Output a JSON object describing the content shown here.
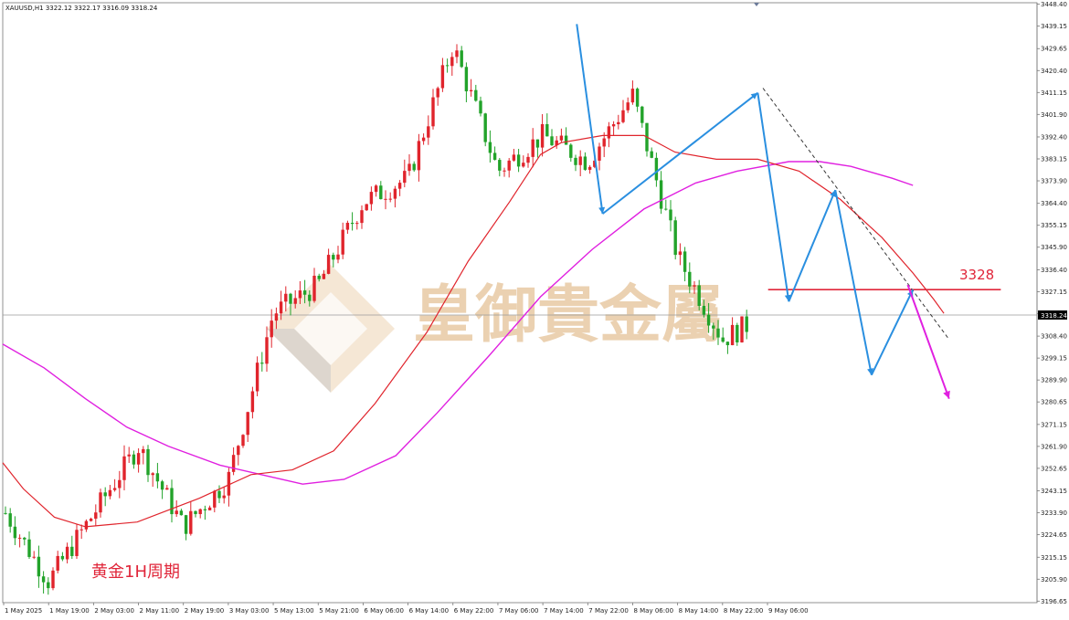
{
  "header": {
    "info": "XAUUSD,H1  3322.12 3322.17 3316.09 3318.24"
  },
  "watermark": {
    "text": "皇御貴金屬"
  },
  "annotations": {
    "period_label": "黄金1H周期",
    "level_label": "3328"
  },
  "colors": {
    "bull": "#e0242c",
    "bear": "#22a32a",
    "ma_fast": "#e0242c",
    "ma_slow": "#e020e0",
    "zigzag": "#2a8fe0",
    "level": "#e0263a",
    "projection": "#e020e0",
    "trend": "#333333"
  },
  "chart_data": {
    "type": "candlestick",
    "symbol": "XAUUSD",
    "timeframe": "H1",
    "current_price": "3318.24",
    "ylim": [
      3196,
      3449
    ],
    "yticks": [
      "3448.40",
      "3439.15",
      "3429.65",
      "3420.40",
      "3411.15",
      "3401.90",
      "3392.40",
      "3383.15",
      "3373.90",
      "3364.40",
      "3355.15",
      "3345.90",
      "3336.40",
      "3327.15",
      "3317.90",
      "3308.40",
      "3299.15",
      "3289.90",
      "3280.65",
      "3271.15",
      "3261.90",
      "3252.65",
      "3243.15",
      "3233.90",
      "3224.65",
      "3215.15",
      "3205.90",
      "3196.65"
    ],
    "xticks": [
      "1 May 2025",
      "1 May 19:00",
      "2 May 03:00",
      "2 May 11:00",
      "2 May 19:00",
      "3 May 03:00",
      "5 May 13:00",
      "5 May 21:00",
      "6 May 06:00",
      "6 May 14:00",
      "6 May 22:00",
      "7 May 06:00",
      "7 May 14:00",
      "7 May 22:00",
      "8 May 06:00",
      "8 May 14:00",
      "8 May 22:00",
      "9 May 06:00"
    ],
    "key_points": [
      {
        "x": "1 May 2025",
        "y": 3235
      },
      {
        "x": "1 May 19:00",
        "y": 3205
      },
      {
        "x": "2 May 11:00",
        "y": 3262
      },
      {
        "x": "2 May 19:00",
        "y": 3228
      },
      {
        "x": "3 May 03:00",
        "y": 3248
      },
      {
        "x": "5 May 13:00",
        "y": 3318
      },
      {
        "x": "5 May 21:00",
        "y": 3330
      },
      {
        "x": "6 May 06:00",
        "y": 3365
      },
      {
        "x": "6 May 14:00",
        "y": 3375
      },
      {
        "x": "6 May 22:00",
        "y": 3431
      },
      {
        "x": "7 May 06:00",
        "y": 3378
      },
      {
        "x": "7 May 14:00",
        "y": 3393
      },
      {
        "x": "7 May 22:00",
        "y": 3382
      },
      {
        "x": "8 May 06:00",
        "y": 3410
      },
      {
        "x": "8 May 14:00",
        "y": 3342
      },
      {
        "x": "8 May 22:00",
        "y": 3307
      },
      {
        "x": "9 May 06:00",
        "y": 3318
      }
    ],
    "ma_fast": [
      [
        0,
        3255
      ],
      [
        0.02,
        3244
      ],
      [
        0.05,
        3232
      ],
      [
        0.08,
        3228
      ],
      [
        0.13,
        3230
      ],
      [
        0.19,
        3240
      ],
      [
        0.24,
        3250
      ],
      [
        0.28,
        3252
      ],
      [
        0.32,
        3260
      ],
      [
        0.36,
        3280
      ],
      [
        0.41,
        3310
      ],
      [
        0.45,
        3340
      ],
      [
        0.49,
        3365
      ],
      [
        0.52,
        3385
      ],
      [
        0.54,
        3390
      ],
      [
        0.58,
        3393
      ],
      [
        0.62,
        3393
      ],
      [
        0.65,
        3386
      ],
      [
        0.69,
        3383
      ],
      [
        0.73,
        3383
      ],
      [
        0.77,
        3378
      ],
      [
        0.81,
        3366
      ],
      [
        0.85,
        3350
      ],
      [
        0.88,
        3335
      ],
      [
        0.9,
        3324
      ],
      [
        0.91,
        3318
      ]
    ],
    "ma_slow": [
      [
        0,
        3305
      ],
      [
        0.04,
        3295
      ],
      [
        0.08,
        3282
      ],
      [
        0.12,
        3270
      ],
      [
        0.16,
        3262
      ],
      [
        0.21,
        3254
      ],
      [
        0.25,
        3250
      ],
      [
        0.29,
        3246
      ],
      [
        0.33,
        3248
      ],
      [
        0.38,
        3258
      ],
      [
        0.42,
        3276
      ],
      [
        0.47,
        3300
      ],
      [
        0.52,
        3325
      ],
      [
        0.57,
        3345
      ],
      [
        0.62,
        3362
      ],
      [
        0.67,
        3373
      ],
      [
        0.71,
        3378
      ],
      [
        0.76,
        3382
      ],
      [
        0.79,
        3382
      ],
      [
        0.82,
        3380
      ],
      [
        0.86,
        3375
      ],
      [
        0.88,
        3372
      ]
    ],
    "zigzag": [
      [
        0.555,
        3440
      ],
      [
        0.58,
        3360
      ],
      [
        0.73,
        3411
      ],
      [
        0.76,
        3323
      ],
      [
        0.805,
        3370
      ],
      [
        0.84,
        3292
      ],
      [
        0.88,
        3328
      ]
    ],
    "trendline": [
      [
        0.735,
        3413
      ],
      [
        0.915,
        3307
      ]
    ],
    "projection": [
      [
        0.875,
        3330
      ],
      [
        0.915,
        3282
      ]
    ],
    "level": {
      "value": 3328,
      "label": "3328",
      "from": 0.74,
      "to": 0.965
    }
  }
}
